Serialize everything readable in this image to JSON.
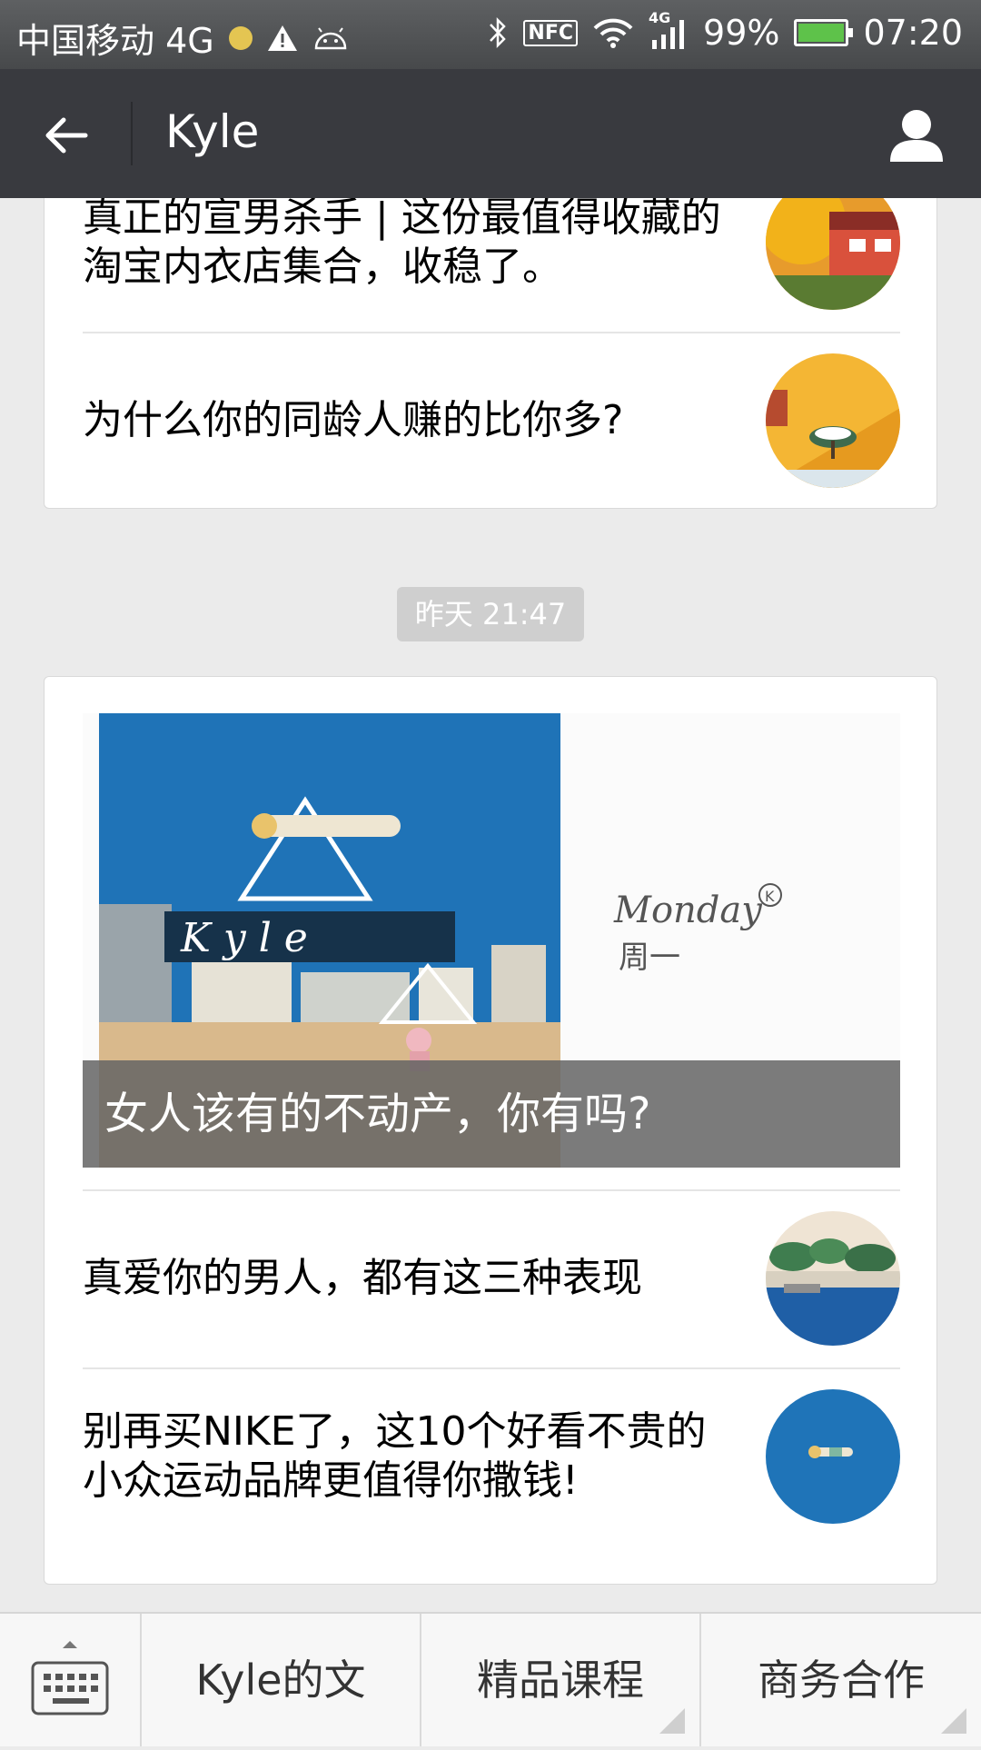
{
  "status_bar": {
    "carrier": "中国移动 4G",
    "nfc": "NFC",
    "network": "4G",
    "battery": "99%",
    "time": "07:20"
  },
  "header": {
    "title": "Kyle"
  },
  "card1": {
    "items": [
      {
        "title": "真正的宣男杀手 | 这份最值得收藏的淘宝内衣店集合，收稳了。",
        "thumb": "autumn-house-thumbnail"
      },
      {
        "title": "为什么你的同龄人赚的比你多?",
        "thumb": "yellow-wall-tree-thumbnail"
      }
    ]
  },
  "timestamp": "昨天 21:47",
  "card2": {
    "cover": {
      "logo_text": "K y l e",
      "brand": "Monday",
      "brand_mark": "K",
      "brand_sub": "周一",
      "title": "女人该有的不动产，你有吗?"
    },
    "items": [
      {
        "title": "真爱你的男人，都有这三种表现",
        "thumb": "lake-trees-thumbnail"
      },
      {
        "title": "别再买NIKE了，这10个好看不贵的小众运动品牌更值得你撒钱!",
        "thumb": "floating-person-thumbnail"
      }
    ]
  },
  "bottom_menu": {
    "items": [
      "Kyle的文",
      "精品课程",
      "商务合作"
    ]
  }
}
